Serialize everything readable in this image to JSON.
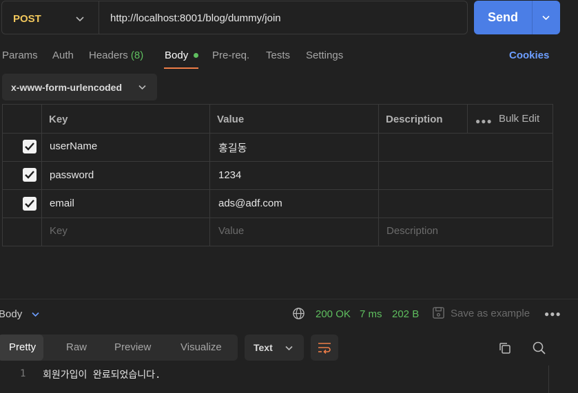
{
  "request": {
    "method": "POST",
    "url": "http://localhost:8001/blog/dummy/join",
    "send_label": "Send"
  },
  "tabs": [
    {
      "label": "Params"
    },
    {
      "label": "Auth"
    },
    {
      "label": "Headers",
      "count": "(8)"
    },
    {
      "label": "Body",
      "active": true
    },
    {
      "label": "Pre-req."
    },
    {
      "label": "Tests"
    },
    {
      "label": "Settings"
    }
  ],
  "cookies_label": "Cookies",
  "body_type": "x-www-form-urlencoded",
  "table": {
    "headers": {
      "key": "Key",
      "value": "Value",
      "description": "Description"
    },
    "bulk_edit": "Bulk Edit",
    "rows": [
      {
        "checked": true,
        "key": "userName",
        "value": "홍길동",
        "description": ""
      },
      {
        "checked": true,
        "key": "password",
        "value": "1234",
        "description": ""
      },
      {
        "checked": true,
        "key": "email",
        "value": "ads@adf.com",
        "description": ""
      }
    ],
    "placeholders": {
      "key": "Key",
      "value": "Value",
      "description": "Description"
    }
  },
  "response": {
    "title": "Body",
    "status": "200 OK",
    "time": "7 ms",
    "size": "202 B",
    "save_label": "Save as example",
    "views": [
      "Pretty",
      "Raw",
      "Preview",
      "Visualize"
    ],
    "active_view": "Pretty",
    "format": "Text",
    "lines": [
      {
        "no": "1",
        "text": "회원가입이 완료되었습니다."
      }
    ]
  },
  "colors": {
    "accent": "#4b7ee6",
    "method": "#f1c75c",
    "success": "#5fbf5f",
    "tab_underline": "#ef7e48",
    "link": "#6d9eff"
  }
}
